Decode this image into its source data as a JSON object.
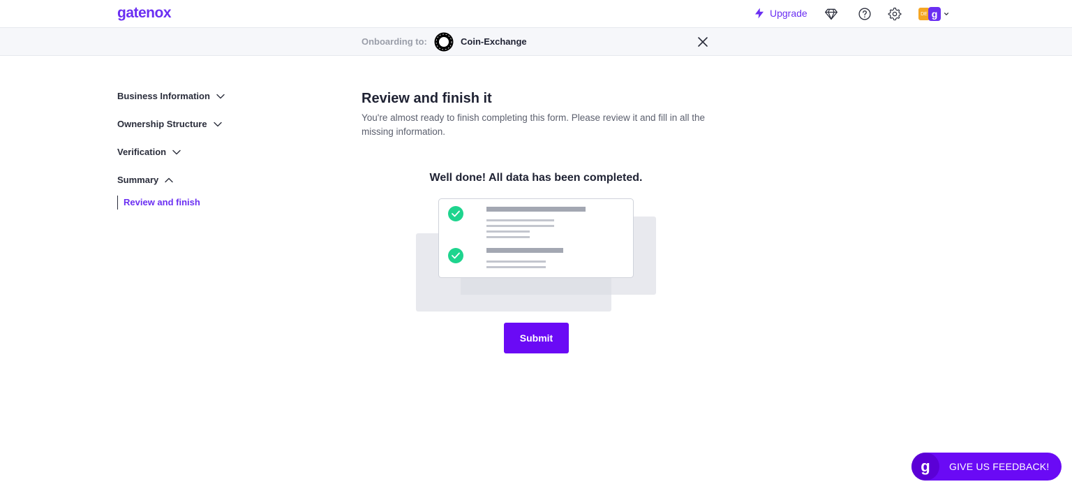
{
  "header": {
    "logo_text": "gatenox",
    "upgrade_label": "Upgrade",
    "avatar_initial": "g",
    "avatar_badge": "DE"
  },
  "onboarding": {
    "label": "Onboarding to:",
    "company": "Coin-Exchange"
  },
  "sidebar": {
    "items": [
      {
        "label": "Business Information",
        "state": "collapsed"
      },
      {
        "label": "Ownership Structure",
        "state": "collapsed"
      },
      {
        "label": "Verification",
        "state": "collapsed"
      },
      {
        "label": "Summary",
        "state": "expanded"
      }
    ],
    "sub_item": "Review and finish"
  },
  "main": {
    "title": "Review and finish it",
    "description": "You're almost ready to finish completing this form. Please review it and fill in all the missing information.",
    "done_message": "Well done! All data has been completed.",
    "submit_label": "Submit"
  },
  "feedback": {
    "logo": "g",
    "label": "GIVE US FEEDBACK!"
  },
  "colors": {
    "brand": "#6b2ff2",
    "button": "#6a0af5",
    "check": "#1ed48e"
  },
  "icons": [
    "bolt-icon",
    "diamond-icon",
    "help-icon",
    "gear-icon",
    "chevron-down-icon",
    "close-icon",
    "check-icon"
  ]
}
